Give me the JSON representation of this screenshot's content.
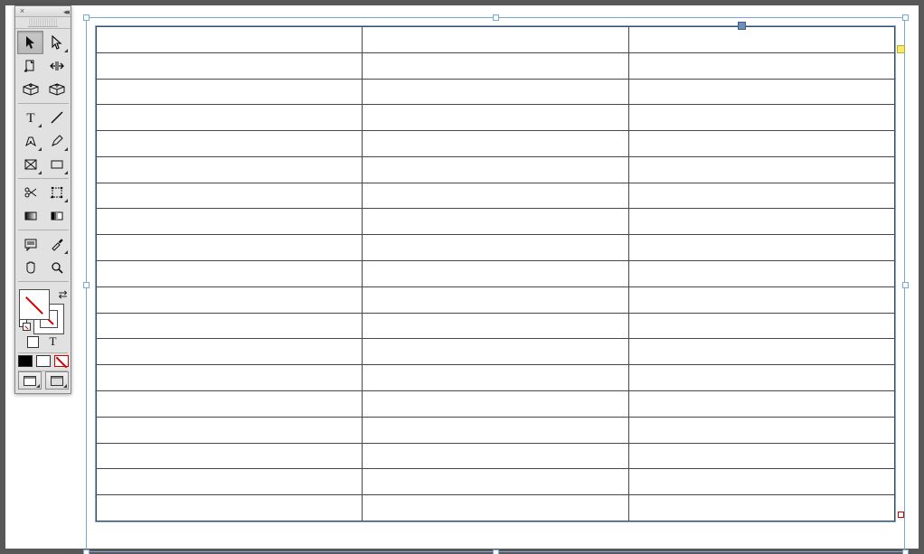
{
  "panel": {
    "close_label": "×",
    "collapse_label": "◂◂"
  },
  "tools": {
    "selection": "Selection Tool",
    "direct_selection": "Direct Selection Tool",
    "page": "Page Tool",
    "gap": "Gap Tool",
    "content_collector": "Content Collector Tool",
    "content_placer": "Content Placer Tool",
    "type": "Type Tool",
    "line": "Line Tool",
    "pen": "Pen Tool",
    "pencil": "Pencil Tool",
    "rectangle_frame": "Rectangle Frame Tool",
    "rectangle": "Rectangle Tool",
    "scissors": "Scissors Tool",
    "free_transform": "Free Transform Tool",
    "gradient_swatch": "Gradient Swatch Tool",
    "gradient_feather": "Gradient Feather Tool",
    "note": "Note Tool",
    "eyedropper": "Eyedropper Tool",
    "hand": "Hand Tool",
    "zoom": "Zoom Tool"
  },
  "swatch": {
    "swap": "⇄",
    "formatting_container": "Formatting affects container",
    "formatting_text_label": "T"
  },
  "table": {
    "columns": 3,
    "rows": 19
  }
}
